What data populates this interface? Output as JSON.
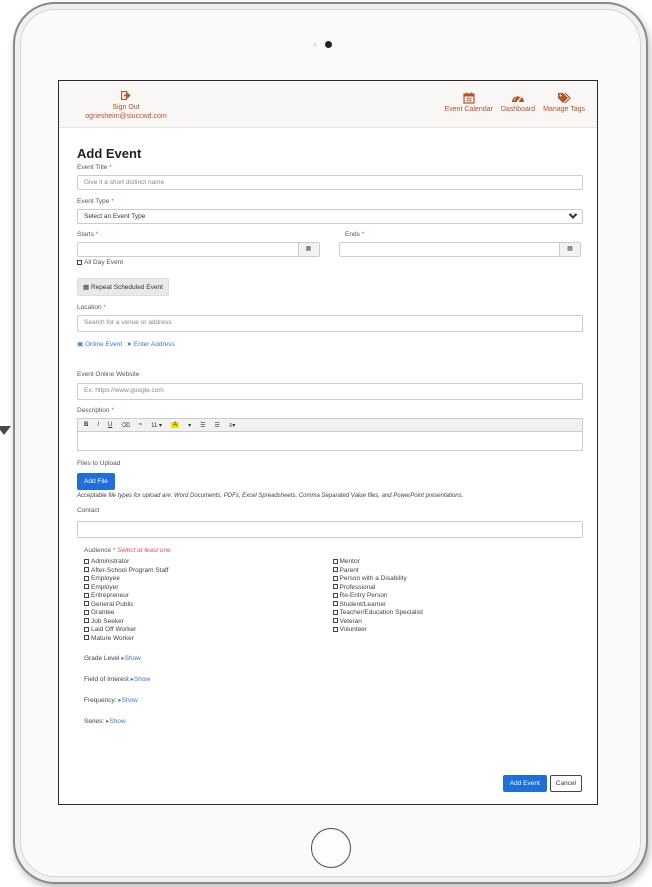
{
  "header": {
    "sign_out": "Sign Out",
    "user_email": "ogriesheim@siuccwd.com",
    "nav": [
      {
        "label": "Event Calendar",
        "icon": "calendar-icon"
      },
      {
        "label": "Dashboard",
        "icon": "dashboard-icon"
      },
      {
        "label": "Manage Tags",
        "icon": "tags-icon"
      }
    ],
    "accent_color": "#b5532a"
  },
  "form": {
    "title": "Add Event",
    "event_title_label": "Event Title",
    "event_title_placeholder": "Give it a short distinct name",
    "event_type_label": "Event Type",
    "event_type_value": "Select an Event Type",
    "starts_label": "Starts",
    "ends_label": "Ends",
    "all_day_label": "All Day Event",
    "repeat_button": "Repeat Scheduled Event",
    "location_label": "Location",
    "location_placeholder": "Search for a venue or address",
    "online_event_link": "Online Event",
    "enter_address_link": "Enter Address",
    "website_label": "Event Online Website",
    "website_placeholder": "Ex: https://www.google.com",
    "description_label": "Description",
    "font_size": "11",
    "files_label": "Files to Upload",
    "add_file_button": "Add File",
    "files_note": "Acceptable file types for upload are: Word Documents, PDFs, Excel Spreadsheets, Comma Separated Value files, and PowerPoint presentations.",
    "contact_label": "Contact",
    "audience_label": "Audience",
    "audience_hint": "Select at least one",
    "audience_left": [
      "Administrator",
      "After-School Program Staff",
      "Employee",
      "Employer",
      "Entrepreneur",
      "General Public",
      "Grantee",
      "Job Seeker",
      "Laid Off Worker",
      "Mature Worker"
    ],
    "audience_right": [
      "Mentor",
      "Parent",
      "Person with a Disability",
      "Professional",
      "Re-Entry Person",
      "Student/Learner",
      "Teacher/Education Specialist",
      "Veteran",
      "Volunteer"
    ],
    "grade_level_label": "Grade Level",
    "field_of_interest_label": "Field of Interest",
    "frequency_label": "Frequency:",
    "series_label": "Series:",
    "show_link": "Show",
    "add_event_button": "Add Event",
    "cancel_button": "Cancel",
    "required_mark": "*",
    "primary_color": "#1e6fd9"
  }
}
